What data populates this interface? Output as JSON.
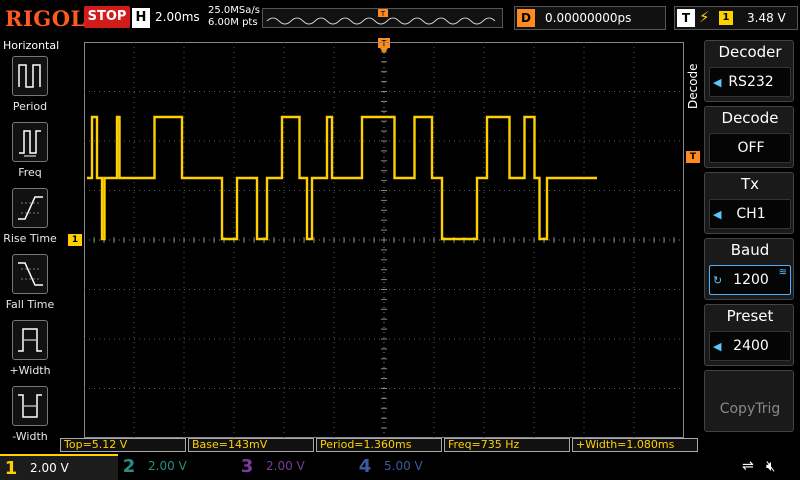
{
  "header": {
    "brand": "RIGOL",
    "run_state": "STOP",
    "horizontal_label": "H",
    "timebase": "2.00ms",
    "sample_rate": "25.0MSa/s",
    "memory_depth": "6.00M pts",
    "delay_label": "D",
    "delay_value": "0.00000000ps",
    "trigger_label": "T",
    "trigger_edge_icon": "rising-edge-icon",
    "trigger_source": "1",
    "trigger_level": "3.48 V"
  },
  "left_menu": {
    "title": "Horizontal",
    "items": [
      {
        "label": "Period",
        "icon": "period-icon"
      },
      {
        "label": "Freq",
        "icon": "frequency-icon"
      },
      {
        "label": "Rise Time",
        "icon": "rise-time-icon"
      },
      {
        "label": "Fall Time",
        "icon": "fall-time-icon"
      },
      {
        "label": "+Width",
        "icon": "positive-width-icon"
      },
      {
        "label": "-Width",
        "icon": "negative-width-icon"
      }
    ]
  },
  "right_menu": {
    "side_label": "Decode",
    "items": [
      {
        "title": "Decoder",
        "value": "RS232"
      },
      {
        "title": "Decode",
        "value": "OFF"
      },
      {
        "title": "Tx",
        "value": "CH1"
      },
      {
        "title": "Baud",
        "value": "1200"
      },
      {
        "title": "Preset",
        "value": "2400"
      },
      {
        "title": "",
        "value": "CopyTrig"
      }
    ]
  },
  "screen": {
    "trigger_marker": "T",
    "ch1_marker": "1",
    "trigger_level_marker": "T"
  },
  "measurements": [
    "Top=5.12 V",
    "Base=143mV",
    "Period=1.360ms",
    "Freq=735 Hz",
    "+Width=1.080ms"
  ],
  "channels": [
    {
      "num": "1",
      "scale": "2.00 V",
      "color": "#ffd000"
    },
    {
      "num": "2",
      "scale": "2.00 V",
      "color": "#2a8d82"
    },
    {
      "num": "3",
      "scale": "2.00 V",
      "color": "#7a3d9c"
    },
    {
      "num": "4",
      "scale": "5.00 V",
      "color": "#3d5aa0"
    }
  ],
  "colors": {
    "trace": "#ffd000",
    "grid": "#5a5a5a",
    "brand": "#ff5a1f",
    "stop": "#d21c1c",
    "trigger": "#ff8a1e"
  },
  "status_icons": [
    "usb-icon",
    "speaker-muted-icon"
  ],
  "chart_data": {
    "type": "line",
    "title": "",
    "xlabel": "",
    "ylabel": "",
    "series": [
      {
        "channel": "CH1",
        "levels": [
          "mid",
          "high",
          "mid",
          "low",
          "mid",
          "high",
          "mid",
          "high",
          "mid",
          "low",
          "mid",
          "low",
          "mid",
          "high",
          "mid",
          "low",
          "mid",
          "high",
          "mid",
          "high",
          "mid",
          "high",
          "mid",
          "low",
          "mid",
          "high",
          "mid",
          "high",
          "mid",
          "low",
          "mid"
        ],
        "durations_div": [
          0.1,
          0.1,
          0.1,
          0.05,
          0.25,
          0.05,
          0.7,
          0.55,
          0.8,
          0.3,
          0.4,
          0.2,
          0.3,
          0.35,
          0.15,
          0.1,
          0.3,
          0.1,
          0.6,
          0.65,
          0.4,
          0.35,
          0.2,
          0.7,
          0.2,
          0.45,
          0.3,
          0.2,
          0.1,
          0.15,
          1.0
        ]
      }
    ],
    "ylim": [
      -4,
      4
    ],
    "y_divisions": 8,
    "x_divisions": 12,
    "grid": true
  }
}
